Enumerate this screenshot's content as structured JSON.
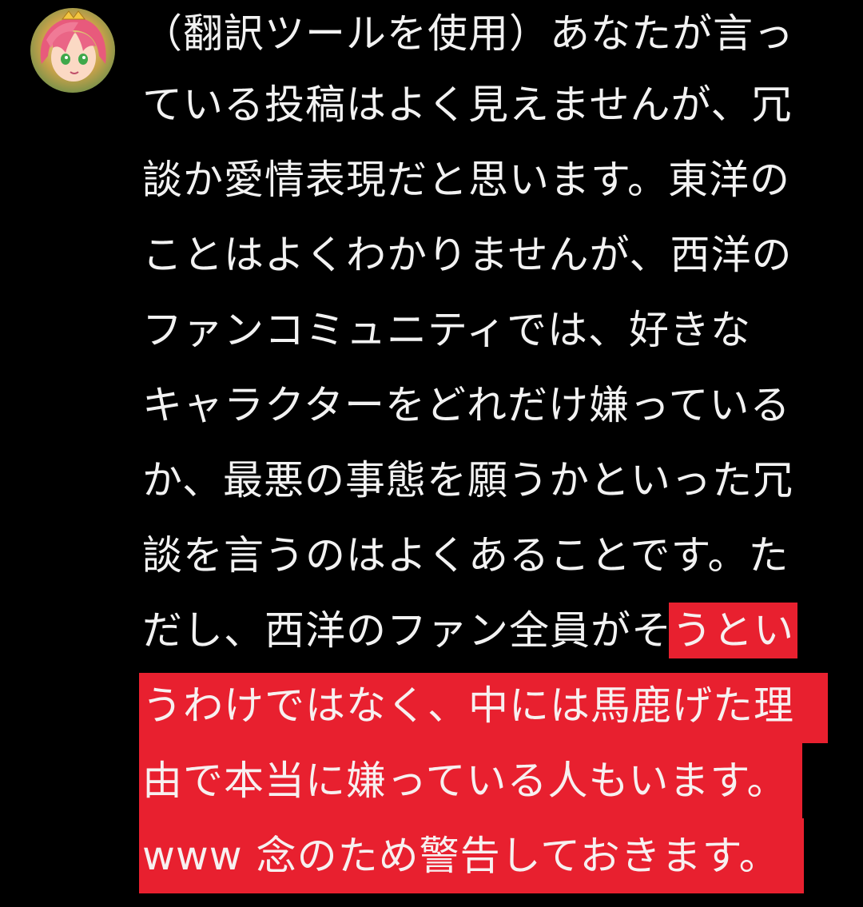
{
  "comment": {
    "lines": [
      "（翻訳ツールを使用）あなたが言っ",
      "ている投稿はよく見えませんが、冗",
      "談か愛情表現だと思います。東洋の",
      "ことはよくわかりませんが、西洋の",
      "ファンコミュニティでは、好きな",
      "キャラクターをどれだけ嫌っている",
      "か、最悪の事態を願うかといった冗",
      "談を言うのはよくあることです。た",
      "だし、西洋のファン全員がそ",
      "うわけではなく、中には馬鹿げた理",
      "由で本当に嫌っている人もいます。",
      "www 念のため警告しておきます。"
    ],
    "highlight_tail": "うとい"
  },
  "colors": {
    "background": "#000000",
    "text": "#f2f2f2",
    "highlight": "#e8202f"
  },
  "avatar": {
    "icon": "anime-character-avatar-icon"
  }
}
